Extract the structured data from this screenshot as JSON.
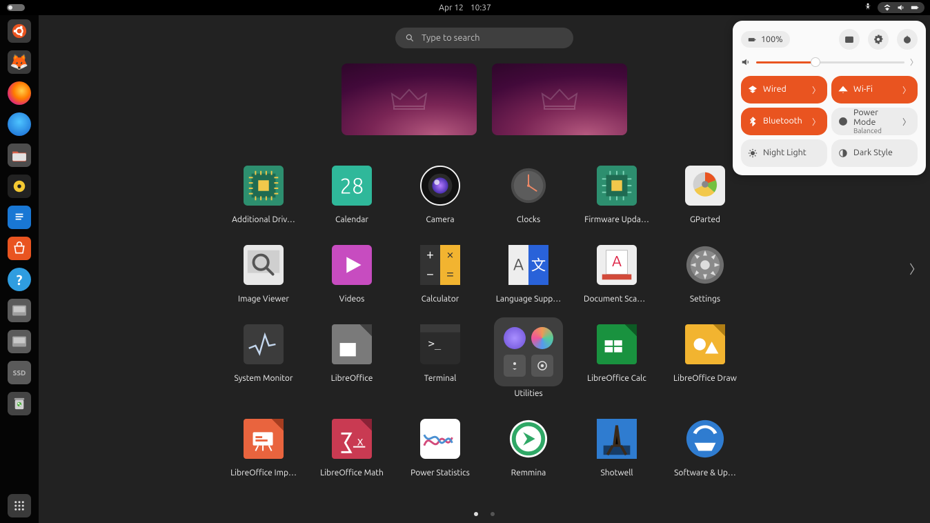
{
  "topbar": {
    "date": "Apr 12",
    "time": "10:37"
  },
  "search": {
    "placeholder": "Type to search"
  },
  "dock": {
    "items": [
      {
        "name": "ubuntu",
        "bg": "#3a3a3a"
      },
      {
        "name": "gimp",
        "bg": "#3a3a3a"
      },
      {
        "name": "firefox",
        "bg": "linear-gradient(#ff8a00,#e52e71)"
      },
      {
        "name": "thunderbird",
        "bg": "linear-gradient(#3fa9f5,#1b6ed6)"
      },
      {
        "name": "files",
        "bg": "#d24a3a"
      },
      {
        "name": "rhythmbox",
        "bg": "#232323"
      },
      {
        "name": "writer",
        "bg": "#1e6fd6"
      },
      {
        "name": "software",
        "bg": "#e95420"
      },
      {
        "name": "help",
        "bg": "#2f9de0"
      },
      {
        "name": "disk-a",
        "bg": "#545454"
      },
      {
        "name": "disk-b",
        "bg": "#545454"
      },
      {
        "name": "ssd",
        "bg": "#545454"
      },
      {
        "name": "trash",
        "bg": "#444"
      }
    ]
  },
  "qs": {
    "pct": "100%",
    "toggles": {
      "wired": {
        "label": "Wired",
        "on": true,
        "chev": true
      },
      "wifi": {
        "label": "Wi-Fi",
        "on": true,
        "chev": true
      },
      "bluetooth": {
        "label": "Bluetooth",
        "on": true,
        "chev": true
      },
      "power": {
        "label": "Power Mode",
        "sub": "Balanced",
        "on": false,
        "chev": true
      },
      "night": {
        "label": "Night Light",
        "on": false,
        "chev": false
      },
      "dark": {
        "label": "Dark Style",
        "on": false,
        "chev": false
      }
    }
  },
  "apps": [
    {
      "label": "Additional Driv…",
      "icon": "drivers"
    },
    {
      "label": "Calendar",
      "icon": "calendar",
      "day": "28"
    },
    {
      "label": "Camera",
      "icon": "camera"
    },
    {
      "label": "Clocks",
      "icon": "clocks"
    },
    {
      "label": "Firmware Upda…",
      "icon": "firmware"
    },
    {
      "label": "GParted",
      "icon": "gparted"
    },
    {
      "label": "Image Viewer",
      "icon": "imgview"
    },
    {
      "label": "Videos",
      "icon": "videos"
    },
    {
      "label": "Calculator",
      "icon": "calc"
    },
    {
      "label": "Language Supp…",
      "icon": "lang"
    },
    {
      "label": "Document Scan…",
      "icon": "docscan"
    },
    {
      "label": "Settings",
      "icon": "settings"
    },
    {
      "label": "System Monitor",
      "icon": "sysmon"
    },
    {
      "label": "LibreOffice",
      "icon": "lo-start"
    },
    {
      "label": "Terminal",
      "icon": "terminal"
    },
    {
      "label": "Utilities",
      "icon": "folder"
    },
    {
      "label": "LibreOffice Calc",
      "icon": "lo-calc"
    },
    {
      "label": "LibreOffice Draw",
      "icon": "lo-draw"
    },
    {
      "label": "LibreOffice Imp…",
      "icon": "lo-impress"
    },
    {
      "label": "LibreOffice Math",
      "icon": "lo-math"
    },
    {
      "label": "Power Statistics",
      "icon": "powerstats"
    },
    {
      "label": "Remmina",
      "icon": "remmina"
    },
    {
      "label": "Shotwell",
      "icon": "shotwell"
    },
    {
      "label": "Software & Up…",
      "icon": "swupd"
    }
  ]
}
